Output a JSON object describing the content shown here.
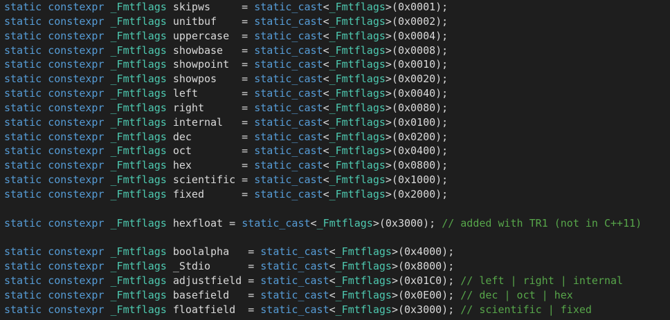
{
  "colors": {
    "background": "#1e1e1e",
    "keyword": "#569cd6",
    "type": "#4ec9b0",
    "plain": "#dadada",
    "comment": "#57a64a"
  },
  "lines": [
    {
      "tokens": [
        {
          "t": "kw",
          "v": "static"
        },
        {
          "t": "txt",
          "v": " "
        },
        {
          "t": "kw",
          "v": "constexpr"
        },
        {
          "t": "txt",
          "v": " "
        },
        {
          "t": "typ",
          "v": "_Fmtflags"
        },
        {
          "t": "txt",
          "v": " skipws     = "
        },
        {
          "t": "kw",
          "v": "static_cast"
        },
        {
          "t": "txt",
          "v": "<"
        },
        {
          "t": "typ",
          "v": "_Fmtflags"
        },
        {
          "t": "txt",
          "v": ">(0x0001);"
        }
      ]
    },
    {
      "tokens": [
        {
          "t": "kw",
          "v": "static"
        },
        {
          "t": "txt",
          "v": " "
        },
        {
          "t": "kw",
          "v": "constexpr"
        },
        {
          "t": "txt",
          "v": " "
        },
        {
          "t": "typ",
          "v": "_Fmtflags"
        },
        {
          "t": "txt",
          "v": " unitbuf    = "
        },
        {
          "t": "kw",
          "v": "static_cast"
        },
        {
          "t": "txt",
          "v": "<"
        },
        {
          "t": "typ",
          "v": "_Fmtflags"
        },
        {
          "t": "txt",
          "v": ">(0x0002);"
        }
      ]
    },
    {
      "tokens": [
        {
          "t": "kw",
          "v": "static"
        },
        {
          "t": "txt",
          "v": " "
        },
        {
          "t": "kw",
          "v": "constexpr"
        },
        {
          "t": "txt",
          "v": " "
        },
        {
          "t": "typ",
          "v": "_Fmtflags"
        },
        {
          "t": "txt",
          "v": " uppercase  = "
        },
        {
          "t": "kw",
          "v": "static_cast"
        },
        {
          "t": "txt",
          "v": "<"
        },
        {
          "t": "typ",
          "v": "_Fmtflags"
        },
        {
          "t": "txt",
          "v": ">(0x0004);"
        }
      ]
    },
    {
      "tokens": [
        {
          "t": "kw",
          "v": "static"
        },
        {
          "t": "txt",
          "v": " "
        },
        {
          "t": "kw",
          "v": "constexpr"
        },
        {
          "t": "txt",
          "v": " "
        },
        {
          "t": "typ",
          "v": "_Fmtflags"
        },
        {
          "t": "txt",
          "v": " showbase   = "
        },
        {
          "t": "kw",
          "v": "static_cast"
        },
        {
          "t": "txt",
          "v": "<"
        },
        {
          "t": "typ",
          "v": "_Fmtflags"
        },
        {
          "t": "txt",
          "v": ">(0x0008);"
        }
      ]
    },
    {
      "tokens": [
        {
          "t": "kw",
          "v": "static"
        },
        {
          "t": "txt",
          "v": " "
        },
        {
          "t": "kw",
          "v": "constexpr"
        },
        {
          "t": "txt",
          "v": " "
        },
        {
          "t": "typ",
          "v": "_Fmtflags"
        },
        {
          "t": "txt",
          "v": " showpoint  = "
        },
        {
          "t": "kw",
          "v": "static_cast"
        },
        {
          "t": "txt",
          "v": "<"
        },
        {
          "t": "typ",
          "v": "_Fmtflags"
        },
        {
          "t": "txt",
          "v": ">(0x0010);"
        }
      ]
    },
    {
      "tokens": [
        {
          "t": "kw",
          "v": "static"
        },
        {
          "t": "txt",
          "v": " "
        },
        {
          "t": "kw",
          "v": "constexpr"
        },
        {
          "t": "txt",
          "v": " "
        },
        {
          "t": "typ",
          "v": "_Fmtflags"
        },
        {
          "t": "txt",
          "v": " showpos    = "
        },
        {
          "t": "kw",
          "v": "static_cast"
        },
        {
          "t": "txt",
          "v": "<"
        },
        {
          "t": "typ",
          "v": "_Fmtflags"
        },
        {
          "t": "txt",
          "v": ">(0x0020);"
        }
      ]
    },
    {
      "tokens": [
        {
          "t": "kw",
          "v": "static"
        },
        {
          "t": "txt",
          "v": " "
        },
        {
          "t": "kw",
          "v": "constexpr"
        },
        {
          "t": "txt",
          "v": " "
        },
        {
          "t": "typ",
          "v": "_Fmtflags"
        },
        {
          "t": "txt",
          "v": " left       = "
        },
        {
          "t": "kw",
          "v": "static_cast"
        },
        {
          "t": "txt",
          "v": "<"
        },
        {
          "t": "typ",
          "v": "_Fmtflags"
        },
        {
          "t": "txt",
          "v": ">(0x0040);"
        }
      ]
    },
    {
      "tokens": [
        {
          "t": "kw",
          "v": "static"
        },
        {
          "t": "txt",
          "v": " "
        },
        {
          "t": "kw",
          "v": "constexpr"
        },
        {
          "t": "txt",
          "v": " "
        },
        {
          "t": "typ",
          "v": "_Fmtflags"
        },
        {
          "t": "txt",
          "v": " right      = "
        },
        {
          "t": "kw",
          "v": "static_cast"
        },
        {
          "t": "txt",
          "v": "<"
        },
        {
          "t": "typ",
          "v": "_Fmtflags"
        },
        {
          "t": "txt",
          "v": ">(0x0080);"
        }
      ]
    },
    {
      "tokens": [
        {
          "t": "kw",
          "v": "static"
        },
        {
          "t": "txt",
          "v": " "
        },
        {
          "t": "kw",
          "v": "constexpr"
        },
        {
          "t": "txt",
          "v": " "
        },
        {
          "t": "typ",
          "v": "_Fmtflags"
        },
        {
          "t": "txt",
          "v": " internal   = "
        },
        {
          "t": "kw",
          "v": "static_cast"
        },
        {
          "t": "txt",
          "v": "<"
        },
        {
          "t": "typ",
          "v": "_Fmtflags"
        },
        {
          "t": "txt",
          "v": ">(0x0100);"
        }
      ]
    },
    {
      "tokens": [
        {
          "t": "kw",
          "v": "static"
        },
        {
          "t": "txt",
          "v": " "
        },
        {
          "t": "kw",
          "v": "constexpr"
        },
        {
          "t": "txt",
          "v": " "
        },
        {
          "t": "typ",
          "v": "_Fmtflags"
        },
        {
          "t": "txt",
          "v": " dec        = "
        },
        {
          "t": "kw",
          "v": "static_cast"
        },
        {
          "t": "txt",
          "v": "<"
        },
        {
          "t": "typ",
          "v": "_Fmtflags"
        },
        {
          "t": "txt",
          "v": ">(0x0200);"
        }
      ]
    },
    {
      "tokens": [
        {
          "t": "kw",
          "v": "static"
        },
        {
          "t": "txt",
          "v": " "
        },
        {
          "t": "kw",
          "v": "constexpr"
        },
        {
          "t": "txt",
          "v": " "
        },
        {
          "t": "typ",
          "v": "_Fmtflags"
        },
        {
          "t": "txt",
          "v": " oct        = "
        },
        {
          "t": "kw",
          "v": "static_cast"
        },
        {
          "t": "txt",
          "v": "<"
        },
        {
          "t": "typ",
          "v": "_Fmtflags"
        },
        {
          "t": "txt",
          "v": ">(0x0400);"
        }
      ]
    },
    {
      "tokens": [
        {
          "t": "kw",
          "v": "static"
        },
        {
          "t": "txt",
          "v": " "
        },
        {
          "t": "kw",
          "v": "constexpr"
        },
        {
          "t": "txt",
          "v": " "
        },
        {
          "t": "typ",
          "v": "_Fmtflags"
        },
        {
          "t": "txt",
          "v": " hex        = "
        },
        {
          "t": "kw",
          "v": "static_cast"
        },
        {
          "t": "txt",
          "v": "<"
        },
        {
          "t": "typ",
          "v": "_Fmtflags"
        },
        {
          "t": "txt",
          "v": ">(0x0800);"
        }
      ]
    },
    {
      "tokens": [
        {
          "t": "kw",
          "v": "static"
        },
        {
          "t": "txt",
          "v": " "
        },
        {
          "t": "kw",
          "v": "constexpr"
        },
        {
          "t": "txt",
          "v": " "
        },
        {
          "t": "typ",
          "v": "_Fmtflags"
        },
        {
          "t": "txt",
          "v": " scientific = "
        },
        {
          "t": "kw",
          "v": "static_cast"
        },
        {
          "t": "txt",
          "v": "<"
        },
        {
          "t": "typ",
          "v": "_Fmtflags"
        },
        {
          "t": "txt",
          "v": ">(0x1000);"
        }
      ]
    },
    {
      "tokens": [
        {
          "t": "kw",
          "v": "static"
        },
        {
          "t": "txt",
          "v": " "
        },
        {
          "t": "kw",
          "v": "constexpr"
        },
        {
          "t": "txt",
          "v": " "
        },
        {
          "t": "typ",
          "v": "_Fmtflags"
        },
        {
          "t": "txt",
          "v": " fixed      = "
        },
        {
          "t": "kw",
          "v": "static_cast"
        },
        {
          "t": "txt",
          "v": "<"
        },
        {
          "t": "typ",
          "v": "_Fmtflags"
        },
        {
          "t": "txt",
          "v": ">(0x2000);"
        }
      ]
    },
    {
      "tokens": []
    },
    {
      "tokens": [
        {
          "t": "kw",
          "v": "static"
        },
        {
          "t": "txt",
          "v": " "
        },
        {
          "t": "kw",
          "v": "constexpr"
        },
        {
          "t": "txt",
          "v": " "
        },
        {
          "t": "typ",
          "v": "_Fmtflags"
        },
        {
          "t": "txt",
          "v": " hexfloat = "
        },
        {
          "t": "kw",
          "v": "static_cast"
        },
        {
          "t": "txt",
          "v": "<"
        },
        {
          "t": "typ",
          "v": "_Fmtflags"
        },
        {
          "t": "txt",
          "v": ">(0x3000); "
        },
        {
          "t": "cmt",
          "v": "// added with TR1 (not in C++11)"
        }
      ]
    },
    {
      "tokens": []
    },
    {
      "tokens": [
        {
          "t": "kw",
          "v": "static"
        },
        {
          "t": "txt",
          "v": " "
        },
        {
          "t": "kw",
          "v": "constexpr"
        },
        {
          "t": "txt",
          "v": " "
        },
        {
          "t": "typ",
          "v": "_Fmtflags"
        },
        {
          "t": "txt",
          "v": " boolalpha   = "
        },
        {
          "t": "kw",
          "v": "static_cast"
        },
        {
          "t": "txt",
          "v": "<"
        },
        {
          "t": "typ",
          "v": "_Fmtflags"
        },
        {
          "t": "txt",
          "v": ">(0x4000);"
        }
      ]
    },
    {
      "tokens": [
        {
          "t": "kw",
          "v": "static"
        },
        {
          "t": "txt",
          "v": " "
        },
        {
          "t": "kw",
          "v": "constexpr"
        },
        {
          "t": "txt",
          "v": " "
        },
        {
          "t": "typ",
          "v": "_Fmtflags"
        },
        {
          "t": "txt",
          "v": " _Stdio      = "
        },
        {
          "t": "kw",
          "v": "static_cast"
        },
        {
          "t": "txt",
          "v": "<"
        },
        {
          "t": "typ",
          "v": "_Fmtflags"
        },
        {
          "t": "txt",
          "v": ">(0x8000);"
        }
      ]
    },
    {
      "tokens": [
        {
          "t": "kw",
          "v": "static"
        },
        {
          "t": "txt",
          "v": " "
        },
        {
          "t": "kw",
          "v": "constexpr"
        },
        {
          "t": "txt",
          "v": " "
        },
        {
          "t": "typ",
          "v": "_Fmtflags"
        },
        {
          "t": "txt",
          "v": " adjustfield = "
        },
        {
          "t": "kw",
          "v": "static_cast"
        },
        {
          "t": "txt",
          "v": "<"
        },
        {
          "t": "typ",
          "v": "_Fmtflags"
        },
        {
          "t": "txt",
          "v": ">(0x01C0); "
        },
        {
          "t": "cmt",
          "v": "// left | right | internal"
        }
      ]
    },
    {
      "tokens": [
        {
          "t": "kw",
          "v": "static"
        },
        {
          "t": "txt",
          "v": " "
        },
        {
          "t": "kw",
          "v": "constexpr"
        },
        {
          "t": "txt",
          "v": " "
        },
        {
          "t": "typ",
          "v": "_Fmtflags"
        },
        {
          "t": "txt",
          "v": " basefield   = "
        },
        {
          "t": "kw",
          "v": "static_cast"
        },
        {
          "t": "txt",
          "v": "<"
        },
        {
          "t": "typ",
          "v": "_Fmtflags"
        },
        {
          "t": "txt",
          "v": ">(0x0E00); "
        },
        {
          "t": "cmt",
          "v": "// dec | oct | hex"
        }
      ]
    },
    {
      "tokens": [
        {
          "t": "kw",
          "v": "static"
        },
        {
          "t": "txt",
          "v": " "
        },
        {
          "t": "kw",
          "v": "constexpr"
        },
        {
          "t": "txt",
          "v": " "
        },
        {
          "t": "typ",
          "v": "_Fmtflags"
        },
        {
          "t": "txt",
          "v": " floatfield  = "
        },
        {
          "t": "kw",
          "v": "static_cast"
        },
        {
          "t": "txt",
          "v": "<"
        },
        {
          "t": "typ",
          "v": "_Fmtflags"
        },
        {
          "t": "txt",
          "v": ">(0x3000); "
        },
        {
          "t": "cmt",
          "v": "// scientific | fixed"
        }
      ]
    }
  ]
}
